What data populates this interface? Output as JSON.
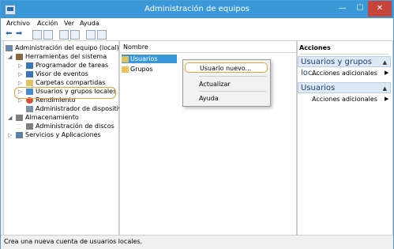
{
  "window": {
    "title": "Administración de equipos",
    "controls": {
      "minimize": "—",
      "maximize": "☐",
      "close": "✕"
    }
  },
  "menubar": {
    "items": [
      "Archivo",
      "Acción",
      "Ver",
      "Ayuda"
    ]
  },
  "tree": {
    "items": [
      {
        "label": "Administración del equipo (local)",
        "icon": "computer-management-icon"
      },
      {
        "label": "Herramientas del sistema",
        "icon": "tools-icon"
      },
      {
        "label": "Programador de tareas",
        "icon": "clock-icon"
      },
      {
        "label": "Visor de eventos",
        "icon": "event-viewer-icon"
      },
      {
        "label": "Carpetas compartidas",
        "icon": "folder-icon"
      },
      {
        "label": "Usuarios y grupos locales",
        "icon": "users-icon"
      },
      {
        "label": "Rendimiento",
        "icon": "performance-icon"
      },
      {
        "label": "Administrador de dispositivos",
        "icon": "device-manager-icon"
      },
      {
        "label": "Almacenamiento",
        "icon": "storage-icon"
      },
      {
        "label": "Administración de discos",
        "icon": "disk-icon"
      },
      {
        "label": "Servicios y Aplicaciones",
        "icon": "services-icon"
      }
    ]
  },
  "list": {
    "header": "Nombre",
    "rows": [
      {
        "label": "Usuarios"
      },
      {
        "label": "Grupos"
      }
    ]
  },
  "context_menu": {
    "items": [
      "Usuario nuevo...",
      "Actualizar",
      "Ayuda"
    ]
  },
  "actions": {
    "title": "Acciones",
    "sections": [
      {
        "header": "Usuarios y grupos loc...",
        "item": "Acciones adicionales"
      },
      {
        "header": "Usuarios",
        "item": "Acciones adicionales"
      }
    ]
  },
  "status": {
    "text": "Crea una nueva cuenta de usuarios locales."
  },
  "colors": {
    "titlebar": "#3b98d8",
    "highlight": "#e5a13a",
    "selection": "#3b98d8"
  }
}
